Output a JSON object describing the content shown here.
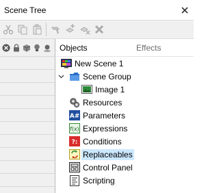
{
  "window": {
    "title": "Scene Tree"
  },
  "columns": {
    "objects": "Objects",
    "effects": "Effects"
  },
  "tree": {
    "root": "New Scene 1",
    "group": "Scene Group",
    "image": "Image 1",
    "resources": "Resources",
    "parameters": "Parameters",
    "expressions": "Expressions",
    "conditions": "Conditions",
    "replaceables": "Replaceables",
    "control_panel": "Control Panel",
    "scripting": "Scripting"
  },
  "icons": {
    "params_glyph": "A#",
    "expr_glyph": "f(x)",
    "cond_glyph": "?:"
  },
  "colors": {
    "selection": "#cce8ff",
    "folder": "#3d7ed8"
  }
}
